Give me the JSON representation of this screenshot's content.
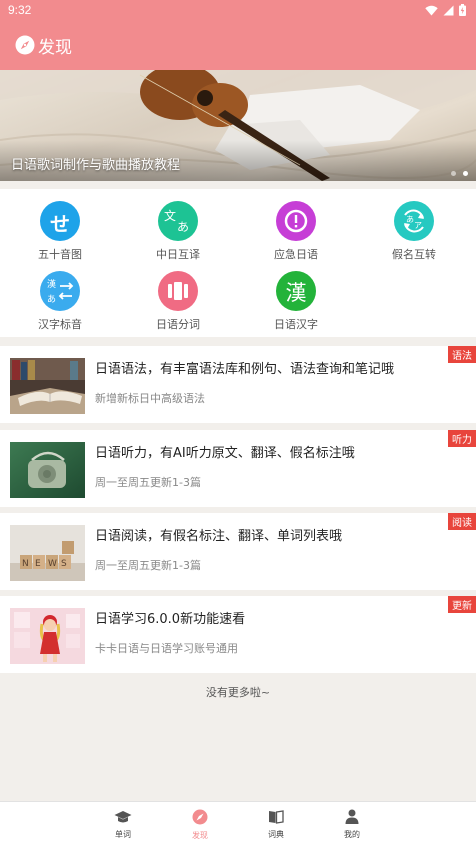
{
  "status": {
    "time": "9:32"
  },
  "header": {
    "title": "发现"
  },
  "banner": {
    "caption": "日语歌词制作与歌曲播放教程",
    "dots": 2,
    "active_dot": 1
  },
  "features": [
    {
      "label": "五十音图",
      "icon": "katakana-se-icon",
      "glyph": "せ",
      "color": "#1ea3e9"
    },
    {
      "label": "中日互译",
      "icon": "translate-icon",
      "glyph": "文あ",
      "color": "#1dc394"
    },
    {
      "label": "应急日语",
      "icon": "alert-icon",
      "glyph": "!",
      "color": "#c63ed6"
    },
    {
      "label": "假名互转",
      "icon": "kana-convert-icon",
      "glyph": "あア",
      "color": "#26c9c1"
    },
    {
      "label": "汉字标音",
      "icon": "kanji-phonetic-icon",
      "glyph": "漢あ",
      "color": "#3aabee"
    },
    {
      "label": "日语分词",
      "icon": "segment-icon",
      "glyph": "▮▮▮",
      "color": "#f06b83"
    },
    {
      "label": "日语汉字",
      "icon": "kanji-icon",
      "glyph": "漢",
      "color": "#23b33a"
    }
  ],
  "articles": [
    {
      "title": "日语语法，有丰富语法库和例句、语法查询和笔记哦",
      "subtitle": "新增新标日中高级语法",
      "tag": "语法",
      "thumb": "books-thumb"
    },
    {
      "title": "日语听力，有AI听力原文、翻译、假名标注哦",
      "subtitle": "周一至周五更新1-3篇",
      "tag": "听力",
      "thumb": "radio-thumb"
    },
    {
      "title": "日语阅读，有假名标注、翻译、单词列表哦",
      "subtitle": "周一至周五更新1-3篇",
      "tag": "阅读",
      "thumb": "news-blocks-thumb"
    },
    {
      "title": "日语学习6.0.0新功能速看",
      "subtitle": "卡卡日语与日语学习账号通用",
      "tag": "更新",
      "thumb": "anime-girl-thumb"
    }
  ],
  "footer_text": "没有更多啦~",
  "tabs": [
    {
      "label": "单词",
      "icon": "graduation-cap-icon",
      "active": false
    },
    {
      "label": "发现",
      "icon": "compass-icon",
      "active": true
    },
    {
      "label": "词典",
      "icon": "book-icon",
      "active": false
    },
    {
      "label": "我的",
      "icon": "person-icon",
      "active": false
    }
  ],
  "colors": {
    "primary": "#f28b8e",
    "tag": "#e8453c",
    "background": "#f2efeb"
  }
}
